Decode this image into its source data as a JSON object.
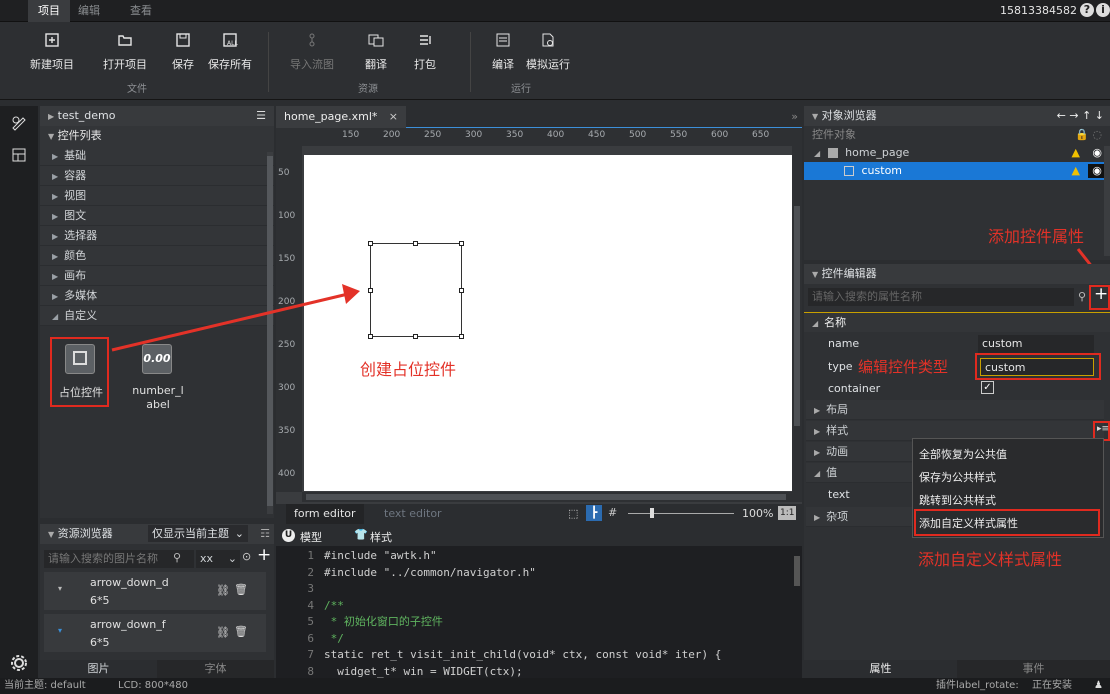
{
  "menubar": {
    "tabs": [
      "项目",
      "编辑",
      "查看"
    ],
    "account": "15813384582",
    "help": "?",
    "info": "i"
  },
  "ribbon": {
    "buttons": [
      {
        "label": "新建项目",
        "icon": "new-project-icon"
      },
      {
        "label": "打开项目",
        "icon": "open-folder-icon"
      },
      {
        "label": "保存",
        "icon": "save-icon"
      },
      {
        "label": "保存所有",
        "icon": "save-all-icon"
      },
      {
        "label": "导入流图",
        "icon": "import-flow-icon"
      },
      {
        "label": "翻译",
        "icon": "translate-icon"
      },
      {
        "label": "打包",
        "icon": "package-icon"
      },
      {
        "label": "编译",
        "icon": "compile-icon"
      },
      {
        "label": "模拟运行",
        "icon": "simulate-icon"
      }
    ],
    "groups": [
      "文件",
      "资源",
      "运行"
    ]
  },
  "project": {
    "name": "test_demo"
  },
  "widgets": {
    "header": "控件列表",
    "categories": [
      "基础",
      "容器",
      "视图",
      "图文",
      "选择器",
      "颜色",
      "画布",
      "多媒体",
      "自定义"
    ],
    "custom_items": [
      {
        "label": "占位控件"
      },
      {
        "label": "number_l\nabel"
      }
    ],
    "placeholder_icon_text": "",
    "number_icon_text": "0.00"
  },
  "editor": {
    "tab": "home_page.xml*",
    "close": "×",
    "ruler_top": [
      "150",
      "200",
      "250",
      "300",
      "350",
      "400",
      "450",
      "500",
      "550",
      "600",
      "650"
    ],
    "ruler_left": [
      "50",
      "100",
      "150",
      "200",
      "250",
      "300",
      "350",
      "400"
    ],
    "bottom_tabs": [
      "form editor",
      "text editor"
    ],
    "zoom": "100%",
    "ratio": "1:1"
  },
  "annotations": {
    "create": "创建占位控件",
    "add_prop": "添加控件属性",
    "edit_type": "编辑控件类型",
    "add_style": "添加自定义样式属性"
  },
  "objbrowser": {
    "title": "对象浏览器",
    "col": "控件对象",
    "root": "home_page",
    "child": "custom"
  },
  "widget_editor": {
    "title": "控件编辑器",
    "search_placeholder": "请输入搜索的属性名称",
    "section_name": "名称",
    "props": [
      {
        "k": "name",
        "v": "custom"
      },
      {
        "k": "type",
        "v": "custom"
      },
      {
        "k": "container",
        "v": "✓"
      }
    ],
    "sections": [
      "布局",
      "样式",
      "动画",
      "值",
      "杂项"
    ],
    "value_key": "text",
    "bottom_tabs": [
      "属性",
      "事件"
    ]
  },
  "context_menu": [
    "全部恢复为公共值",
    "保存为公共样式",
    "跳转到公共样式",
    "添加自定义样式属性"
  ],
  "resources": {
    "title": "资源浏览器",
    "filter": "仅显示当前主题",
    "search_placeholder": "请输入搜索的图片名称",
    "type": "xx",
    "items": [
      {
        "name": "arrow_down_d",
        "size": "6*5"
      },
      {
        "name": "arrow_down_f",
        "size": "6*5"
      }
    ],
    "bottom_tabs": [
      "图片",
      "字体"
    ]
  },
  "code": {
    "tabs": [
      "模型",
      "样式"
    ],
    "lines": [
      {
        "n": "1",
        "t": "#include \"awtk.h\""
      },
      {
        "n": "2",
        "t": "#include \"../common/navigator.h\""
      },
      {
        "n": "3",
        "t": ""
      },
      {
        "n": "4",
        "t": "/**"
      },
      {
        "n": "5",
        "t": " * 初始化窗口的子控件"
      },
      {
        "n": "6",
        "t": " */"
      },
      {
        "n": "7",
        "t": "static ret_t visit_init_child(void* ctx, const void* iter) {"
      },
      {
        "n": "8",
        "t": "  widget_t* win = WIDGET(ctx);"
      }
    ]
  },
  "status": {
    "theme": "当前主题: default",
    "lcd": "LCD: 800*480",
    "plugin": "插件label_rotate:",
    "install": "正在安装"
  }
}
